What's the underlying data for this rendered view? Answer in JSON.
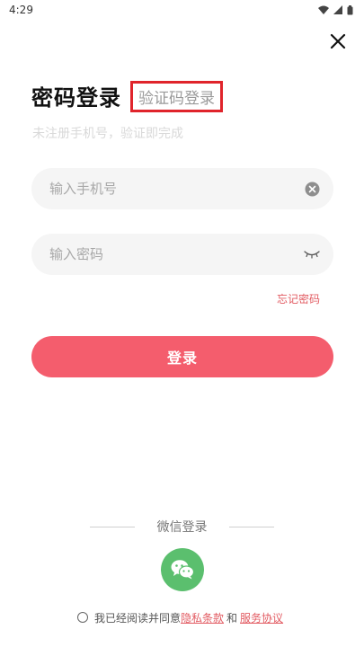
{
  "status_bar": {
    "time": "4:29"
  },
  "header": {
    "title": "密码登录",
    "alt_tab": "验证码登录",
    "subtitle": "未注册手机号，验证即完成"
  },
  "form": {
    "phone_placeholder": "输入手机号",
    "password_placeholder": "输入密码",
    "forgot_label": "忘记密码",
    "login_label": "登录"
  },
  "third_party": {
    "label": "微信登录"
  },
  "agreement": {
    "prefix": "我已经阅读并同意",
    "privacy_link": "隐私条款",
    "conjunction": "和",
    "service_link": "服务协议"
  },
  "colors": {
    "accent": "#f45d6d",
    "link": "#e25b62",
    "wechat": "#5bbf6e",
    "highlight_box": "#e0242b"
  },
  "icons": [
    "wifi-icon",
    "signal-icon",
    "battery-icon",
    "close-icon",
    "clear-icon",
    "eye-closed-icon",
    "wechat-icon"
  ]
}
